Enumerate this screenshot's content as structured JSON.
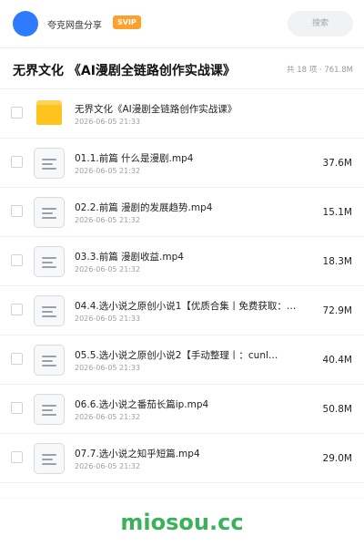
{
  "topbar": {
    "user_name": "夸克网盘分享",
    "vip_label": "SVIP",
    "search_placeholder": "搜索"
  },
  "header": {
    "folder_title": "无界文化 《AI漫剧全链路创作实战课》",
    "folder_meta": "共 18 项 · 761.8M"
  },
  "files": [
    {
      "type": "folder",
      "name": "无界文化《AI漫剧全链路创作实战课》",
      "date": "2026-06-05 21:33",
      "size": ""
    },
    {
      "type": "file",
      "name": "01.1.前篇 什么是漫剧.mp4",
      "date": "2026-06-05 21:32",
      "size": "37.6M"
    },
    {
      "type": "file",
      "name": "02.2.前篇 漫剧的发展趋势.mp4",
      "date": "2026-06-05 21:32",
      "size": "15.1M"
    },
    {
      "type": "file",
      "name": "03.3.前篇 漫剧收益.mp4",
      "date": "2026-06-05 21:32",
      "size": "18.3M"
    },
    {
      "type": "file",
      "name": "04.4.选小说之原创小说1【优质合集丨免费获取：…",
      "date": "2026-06-05 21:33",
      "size": "72.9M"
    },
    {
      "type": "file",
      "name": "05.5.选小说之原创小说2【手动整理丨：cunl…",
      "date": "2026-06-05 21:33",
      "size": "40.4M"
    },
    {
      "type": "file",
      "name": "06.6.选小说之番茄长篇ip.mp4",
      "date": "2026-06-05 21:32",
      "size": "50.8M"
    },
    {
      "type": "file",
      "name": "07.7.选小说之知乎短篇.mp4",
      "date": "2026-06-05 21:32",
      "size": "29.0M"
    }
  ],
  "footer": {
    "watermark": "miosou.cc"
  },
  "colors": {
    "accent": "#2f7bff",
    "vip": "#ff9f2e",
    "folder": "#ffc21f",
    "watermark": "#3ab25a"
  }
}
